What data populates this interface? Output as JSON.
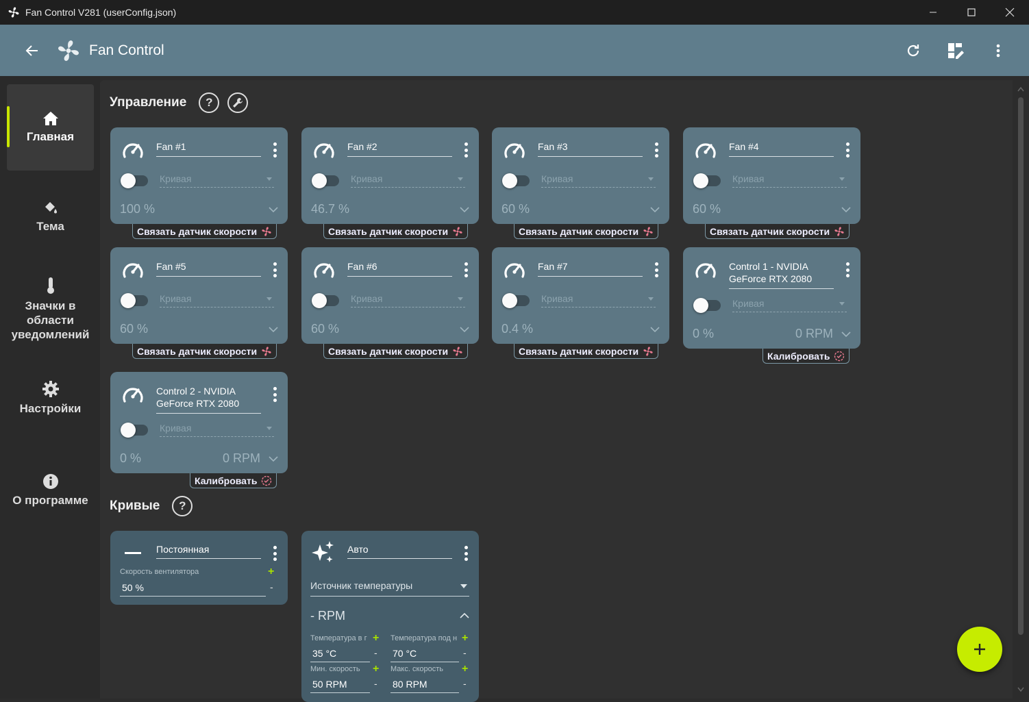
{
  "window": {
    "title": "Fan Control V281 (userConfig.json)",
    "minimize": "—",
    "maximize": "☐",
    "close": "✕"
  },
  "appbar": {
    "title": "Fan Control"
  },
  "sidebar": {
    "items": [
      {
        "label": "Главная",
        "icon": "home-icon",
        "active": true
      },
      {
        "label": "Тема",
        "icon": "paint-bucket-icon"
      },
      {
        "label": "Значки в области уведомлений",
        "icon": "thermometer-icon"
      },
      {
        "label": "Настройки",
        "icon": "gear-icon"
      },
      {
        "label": "О программе",
        "icon": "info-icon"
      }
    ]
  },
  "controls": {
    "title": "Управление",
    "help": "?",
    "curve_placeholder": "Кривая",
    "pair_label": "Связать датчик скорости",
    "calibrate_label": "Калибровать",
    "cards": [
      {
        "name": "Fan #1",
        "percent": "100 %"
      },
      {
        "name": "Fan #2",
        "percent": "46.7 %"
      },
      {
        "name": "Fan #3",
        "percent": "60 %"
      },
      {
        "name": "Fan #4",
        "percent": "60 %"
      },
      {
        "name": "Fan #5",
        "percent": "60 %"
      },
      {
        "name": "Fan #6",
        "percent": "60 %"
      },
      {
        "name": "Fan #7",
        "percent": "0.4 %"
      },
      {
        "name": "Control 1 - NVIDIA GeForce RTX 2080",
        "percent": "0 %",
        "rpm": "0 RPM"
      },
      {
        "name": "Control 2 - NVIDIA GeForce RTX 2080",
        "percent": "0 %",
        "rpm": "0 RPM"
      }
    ]
  },
  "curves": {
    "title": "Кривые",
    "help": "?",
    "constant": {
      "name": "Постоянная",
      "speed_label": "Скорость вентилятора",
      "speed_value": "50 %"
    },
    "auto": {
      "name": "Авто",
      "temp_source": "Источник температуры",
      "rpm": "- RPM",
      "temp_idle_label": "Температура в г",
      "temp_idle_value": "35 °C",
      "temp_load_label": "Температура под н",
      "temp_load_value": "70 °C",
      "min_speed_label": "Мин. скорость",
      "min_speed_value": "50 RPM",
      "max_speed_label": "Макс. скорость",
      "max_speed_value": "80 RPM"
    }
  },
  "colors": {
    "accent": "#c6ec00",
    "card": "#5d7784",
    "appbar": "#5f7d8c",
    "fan_pink": "#e87a90"
  }
}
